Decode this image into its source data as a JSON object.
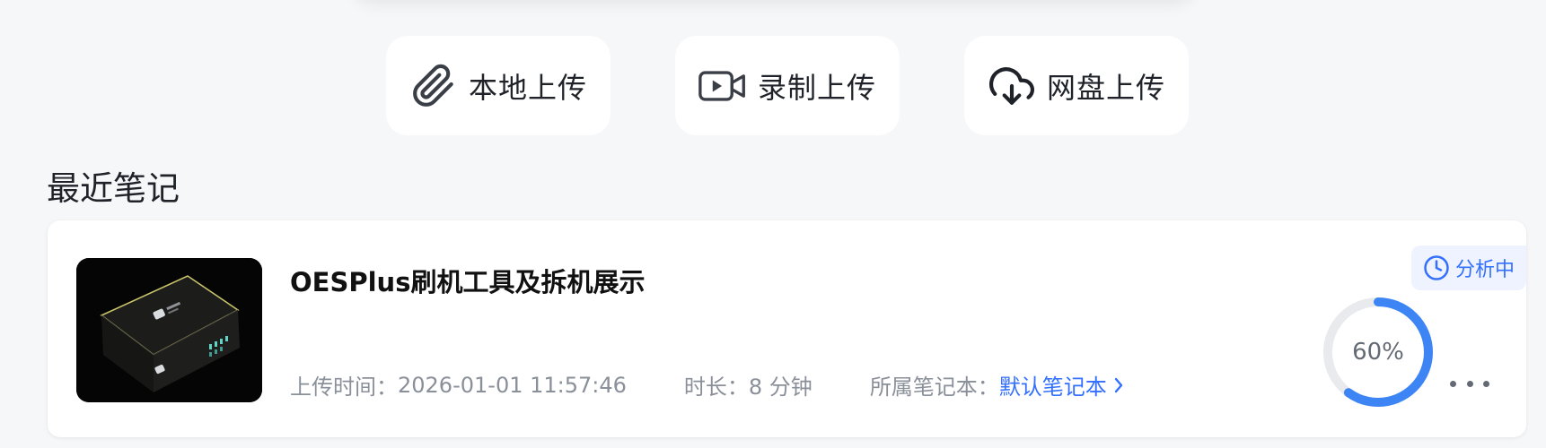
{
  "upload_buttons": [
    {
      "label": "本地上传",
      "icon": "paperclip-icon"
    },
    {
      "label": "录制上传",
      "icon": "video-camera-icon"
    },
    {
      "label": "网盘上传",
      "icon": "cloud-download-icon"
    }
  ],
  "recent": {
    "section_title": "最近笔记",
    "notes": [
      {
        "title": "OESPlus刷机工具及拆机展示",
        "upload_time_label": "上传时间：",
        "upload_time": "2026-01-01 11:57:46",
        "duration_label": "时长：",
        "duration": "8 分钟",
        "notebook_label": "所属笔记本：",
        "notebook": "默认笔记本",
        "status": "分析中",
        "progress_text": "60%",
        "progress_value": 0.6
      }
    ]
  },
  "colors": {
    "accent": "#3370ff",
    "progress": "#3d85f5",
    "background": "#f6f7f9"
  }
}
